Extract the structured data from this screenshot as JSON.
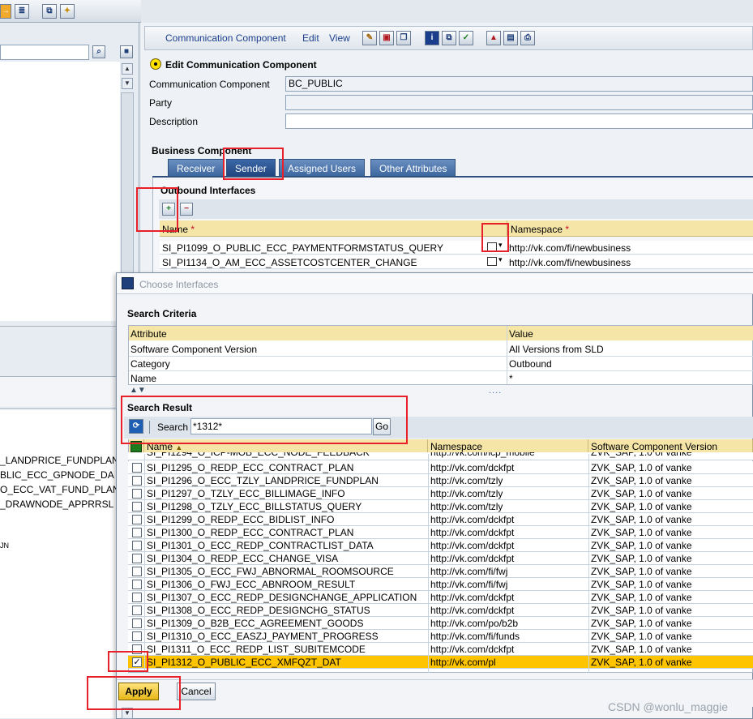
{
  "menu": {
    "communication_component": "Communication Component",
    "edit": "Edit",
    "view": "View"
  },
  "edit_panel": {
    "title": "Edit Communication Component",
    "comm_component_label": "Communication Component",
    "comm_component_value": "BC_PUBLIC",
    "party_label": "Party",
    "party_value": "",
    "description_label": "Description",
    "description_value": ""
  },
  "business_component": {
    "title": "Business Component",
    "tabs": [
      {
        "label": "Receiver"
      },
      {
        "label": "Sender"
      },
      {
        "label": "Assigned Users"
      },
      {
        "label": "Other Attributes"
      }
    ],
    "outbound_title": "Outbound Interfaces",
    "columns": {
      "name": "Name",
      "namespace": "Namespace",
      "required_marker": "*"
    },
    "rows": [
      {
        "name": "SI_PI1099_O_PUBLIC_ECC_PAYMENTFORMSTATUS_QUERY",
        "namespace": "http://vk.com/fi/newbusiness"
      },
      {
        "name": "SI_PI1134_O_AM_ECC_ASSETCOSTCENTER_CHANGE",
        "namespace": "http://vk.com/fi/newbusiness"
      }
    ]
  },
  "left_panel": {
    "items": [
      "_LANDPRICE_FUNDPLAN",
      "BLIC_ECC_GPNODE_DA",
      "O_ECC_VAT_FUND_PLAN",
      "_DRAWNODE_APPRRSL"
    ]
  },
  "dialog": {
    "title": "Choose Interfaces",
    "criteria_title": "Search Criteria",
    "criteria_columns": {
      "attribute": "Attribute",
      "value": "Value"
    },
    "criteria_rows": [
      {
        "attribute": "Software Component Version",
        "value": "All Versions from SLD"
      },
      {
        "attribute": "Category",
        "value": "Outbound"
      },
      {
        "attribute": "Name",
        "value": "*"
      }
    ],
    "splitter_dots": "....",
    "result_title": "Search Result",
    "search_label": "Search",
    "search_value": "*1312*",
    "go_label": "Go",
    "result_columns": {
      "name": "Name",
      "namespace": "Namespace",
      "scv": "Software Component Version"
    },
    "partial_row": {
      "name": "SI_PI1294_O_ICP-MOB_ECC_NODE_FEEDBACK",
      "namespace": "http://vk.com/icp_mobile",
      "scv": "ZVK_SAP, 1.0 of vanke"
    },
    "results": [
      {
        "name": "SI_PI1295_O_REDP_ECC_CONTRACT_PLAN",
        "namespace": "http://vk.com/dckfpt",
        "scv": "ZVK_SAP, 1.0 of vanke",
        "checked": false
      },
      {
        "name": "SI_PI1296_O_ECC_TZLY_LANDPRICE_FUNDPLAN",
        "namespace": "http://vk.com/tzly",
        "scv": "ZVK_SAP, 1.0 of vanke",
        "checked": false
      },
      {
        "name": "SI_PI1297_O_TZLY_ECC_BILLIMAGE_INFO",
        "namespace": "http://vk.com/tzly",
        "scv": "ZVK_SAP, 1.0 of vanke",
        "checked": false
      },
      {
        "name": "SI_PI1298_O_TZLY_ECC_BILLSTATUS_QUERY",
        "namespace": "http://vk.com/tzly",
        "scv": "ZVK_SAP, 1.0 of vanke",
        "checked": false
      },
      {
        "name": "SI_PI1299_O_REDP_ECC_BIDLIST_INFO",
        "namespace": "http://vk.com/dckfpt",
        "scv": "ZVK_SAP, 1.0 of vanke",
        "checked": false
      },
      {
        "name": "SI_PI1300_O_REDP_ECC_CONTRACT_PLAN",
        "namespace": "http://vk.com/dckfpt",
        "scv": "ZVK_SAP, 1.0 of vanke",
        "checked": false
      },
      {
        "name": "SI_PI1301_O_ECC_REDP_CONTRACTLIST_DATA",
        "namespace": "http://vk.com/dckfpt",
        "scv": "ZVK_SAP, 1.0 of vanke",
        "checked": false
      },
      {
        "name": "SI_PI1304_O_REDP_ECC_CHANGE_VISA",
        "namespace": "http://vk.com/dckfpt",
        "scv": "ZVK_SAP, 1.0 of vanke",
        "checked": false
      },
      {
        "name": "SI_PI1305_O_ECC_FWJ_ABNORMAL_ROOMSOURCE",
        "namespace": "http://vk.com/fi/fwj",
        "scv": "ZVK_SAP, 1.0 of vanke",
        "checked": false
      },
      {
        "name": "SI_PI1306_O_FWJ_ECC_ABNROOM_RESULT",
        "namespace": "http://vk.com/fi/fwj",
        "scv": "ZVK_SAP, 1.0 of vanke",
        "checked": false
      },
      {
        "name": "SI_PI1307_O_ECC_REDP_DESIGNCHANGE_APPLICATION",
        "namespace": "http://vk.com/dckfpt",
        "scv": "ZVK_SAP, 1.0 of vanke",
        "checked": false
      },
      {
        "name": "SI_PI1308_O_ECC_REDP_DESIGNCHG_STATUS",
        "namespace": "http://vk.com/dckfpt",
        "scv": "ZVK_SAP, 1.0 of vanke",
        "checked": false
      },
      {
        "name": "SI_PI1309_O_B2B_ECC_AGREEMENT_GOODS",
        "namespace": "http://vk.com/po/b2b",
        "scv": "ZVK_SAP, 1.0 of vanke",
        "checked": false
      },
      {
        "name": "SI_PI1310_O_ECC_EASZJ_PAYMENT_PROGRESS",
        "namespace": "http://vk.com/fi/funds",
        "scv": "ZVK_SAP, 1.0 of vanke",
        "checked": false
      },
      {
        "name": "SI_PI1311_O_ECC_REDP_LIST_SUBITEMCODE",
        "namespace": "http://vk.com/dckfpt",
        "scv": "ZVK_SAP, 1.0 of vanke",
        "checked": false
      },
      {
        "name": "SI_PI1312_O_PUBLIC_ECC_XMFQZT_DAT",
        "namespace": "http://vk.com/pl",
        "scv": "ZVK_SAP, 1.0 of vanke",
        "checked": true,
        "check_mark": "✓"
      }
    ],
    "apply_label": "Apply",
    "cancel_label": "Cancel"
  },
  "watermark": "CSDN @wonlu_maggie",
  "colors": {
    "sap_blue": "#1a3e8c",
    "tab_blue": "#3d679f",
    "header_yellow": "#f5e6a8",
    "selected_row": "#ffc400",
    "annotation_red": "#e8202a"
  }
}
